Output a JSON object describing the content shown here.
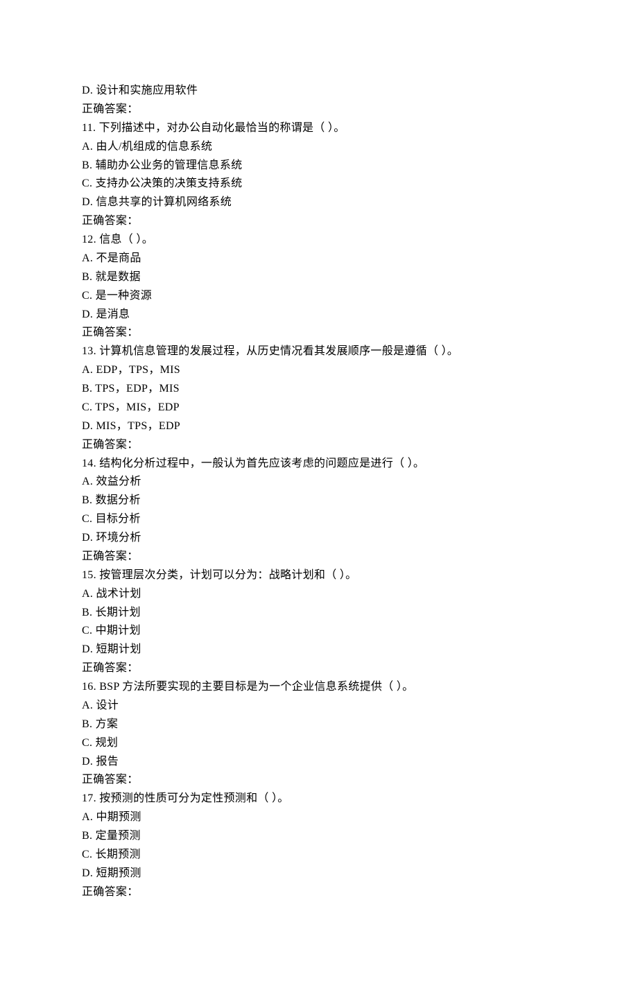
{
  "items": [
    {
      "text": "D.  设计和实施应用软件"
    },
    {
      "text": "正确答案："
    },
    {
      "text": "11.   下列描述中，对办公自动化最恰当的称谓是（ ）。"
    },
    {
      "text": "A.  由人/机组成的信息系统"
    },
    {
      "text": "B.  辅助办公业务的管理信息系统"
    },
    {
      "text": "C.  支持办公决策的决策支持系统"
    },
    {
      "text": "D.  信息共享的计算机网络系统"
    },
    {
      "text": "正确答案："
    },
    {
      "text": "12.   信息（ ）。"
    },
    {
      "text": "A.  不是商品"
    },
    {
      "text": "B.  就是数据"
    },
    {
      "text": "C.  是一种资源"
    },
    {
      "text": "D.  是消息"
    },
    {
      "text": "正确答案："
    },
    {
      "text": "13.   计算机信息管理的发展过程，从历史情况看其发展顺序一般是遵循（ ）。"
    },
    {
      "text": "A. EDP，TPS，MIS"
    },
    {
      "text": "B. TPS，EDP，MIS"
    },
    {
      "text": "C. TPS，MIS，EDP"
    },
    {
      "text": "D. MIS，TPS，EDP"
    },
    {
      "text": "正确答案："
    },
    {
      "text": "14.   结构化分析过程中，一般认为首先应该考虑的问题应是进行（ ）。"
    },
    {
      "text": "A.  效益分析"
    },
    {
      "text": "B.  数据分析"
    },
    {
      "text": "C.  目标分析"
    },
    {
      "text": "D.  环境分析"
    },
    {
      "text": "正确答案："
    },
    {
      "text": "15.   按管理层次分类，计划可以分为：战略计划和（ ）。"
    },
    {
      "text": "A.  战术计划"
    },
    {
      "text": "B.  长期计划"
    },
    {
      "text": "C.  中期计划"
    },
    {
      "text": "D.  短期计划"
    },
    {
      "text": "正确答案："
    },
    {
      "text": "16.   BSP 方法所要实现的主要目标是为一个企业信息系统提供（ ）。"
    },
    {
      "text": "A.  设计"
    },
    {
      "text": "B.  方案"
    },
    {
      "text": "C.  规划"
    },
    {
      "text": "D.  报告"
    },
    {
      "text": "正确答案："
    },
    {
      "text": "17.   按预测的性质可分为定性预测和（ ）。"
    },
    {
      "text": "A.  中期预测"
    },
    {
      "text": "B.  定量预测"
    },
    {
      "text": "C.  长期预测"
    },
    {
      "text": "D.  短期预测"
    },
    {
      "text": "正确答案："
    }
  ]
}
